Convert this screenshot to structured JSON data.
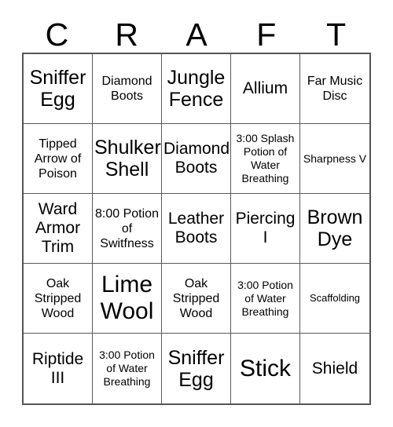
{
  "card": {
    "header_letters": [
      "C",
      "R",
      "A",
      "F",
      "T"
    ],
    "grid_line_color": "#5a5a5a",
    "border_color": "#555555",
    "text_color": "#000000",
    "background_color": "#ffffff",
    "columns": 5,
    "rows": 5,
    "cells": [
      {
        "text": "Sniffer Egg",
        "size": "lg"
      },
      {
        "text": "Diamond Boots",
        "size": "sm"
      },
      {
        "text": "Jungle Fence",
        "size": "lg"
      },
      {
        "text": "Allium",
        "size": "md"
      },
      {
        "text": "Far Music Disc",
        "size": "sm"
      },
      {
        "text": "Tipped Arrow of Poison",
        "size": "sm"
      },
      {
        "text": "Shulker Shell",
        "size": "lg"
      },
      {
        "text": "Diamond Boots",
        "size": "md"
      },
      {
        "text": "3:00 Splash Potion of Water Breathing",
        "size": "xs"
      },
      {
        "text": "Sharpness V",
        "size": "xs"
      },
      {
        "text": "Ward Armor Trim",
        "size": "md"
      },
      {
        "text": "8:00 Potion of Switfness",
        "size": "sm"
      },
      {
        "text": "Leather Boots",
        "size": "md"
      },
      {
        "text": "Piercing I",
        "size": "md"
      },
      {
        "text": "Brown Dye",
        "size": "lg"
      },
      {
        "text": "Oak Stripped Wood",
        "size": "sm"
      },
      {
        "text": "Lime Wool",
        "size": "xl"
      },
      {
        "text": "Oak Stripped Wood",
        "size": "sm"
      },
      {
        "text": "3:00 Potion of Water Breathing",
        "size": "xs"
      },
      {
        "text": "Scaffolding",
        "size": "xxs"
      },
      {
        "text": "Riptide III",
        "size": "md"
      },
      {
        "text": "3:00 Potion of Water Breathing",
        "size": "xs"
      },
      {
        "text": "Sniffer Egg",
        "size": "lg"
      },
      {
        "text": "Stick",
        "size": "xl"
      },
      {
        "text": "Shield",
        "size": "md"
      }
    ]
  }
}
